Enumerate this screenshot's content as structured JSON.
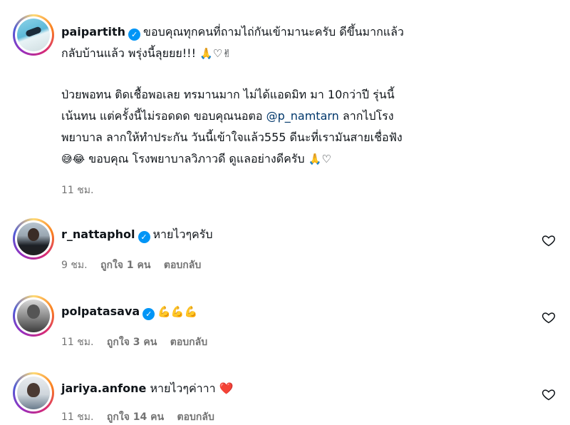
{
  "post": {
    "username": "paipartith",
    "lines": [
      "ขอบคุณทุกคนที่ถามไถ่กันเข้ามานะครับ ดีขึ้นมากแล้ว",
      "กลับบ้านแล้ว พรุ่งนี้ลุยยย!!!",
      "ป่วยพอทน ติดเชื้อพอเลย ทรมานมาก ไม่ได้แอดมิท มา 10กว่าปี รุ่นนี้",
      "เน้นทน แต่ครั้งนี้ไม่รอดดด ขอบคุณนอตอ",
      "พยาบาล ลากให้ทำประกัน วันนี้เข้าใจแล้ว555 ดีนะที่เรามันสายเชื่อฟัง",
      "ขอบคุณ โรงพยาบาลวิภาวดี ดูแลอย่างดีครับ"
    ],
    "mention": "@p_namtarn",
    "mention_after": "ลากไปโรง",
    "emoji_line2": "🙏♡✌",
    "emoji_line6_pre": "😅😂",
    "emoji_line6_post": "🙏♡",
    "time": "11 ชม."
  },
  "comments": [
    {
      "username": "r_nattaphol",
      "text": "หายไวๆครับ",
      "time": "9 ชม.",
      "likes": "ถูกใจ 1 คน",
      "reply": "ตอบกลับ"
    },
    {
      "username": "polpatasava",
      "text": "💪💪💪",
      "time": "11 ชม.",
      "likes": "ถูกใจ 3 คน",
      "reply": "ตอบกลับ"
    },
    {
      "username": "jariya.anfone",
      "text": "หายไวๆค่าาา ❤️",
      "time": "11 ชม.",
      "likes": "ถูกใจ 14 คน",
      "reply": "ตอบกลับ"
    }
  ],
  "icons": {
    "verified": "verified-badge-icon",
    "like": "heart-outline-icon"
  },
  "colors": {
    "verified": "#0095f6",
    "mention": "#00376b",
    "meta": "#737373"
  }
}
